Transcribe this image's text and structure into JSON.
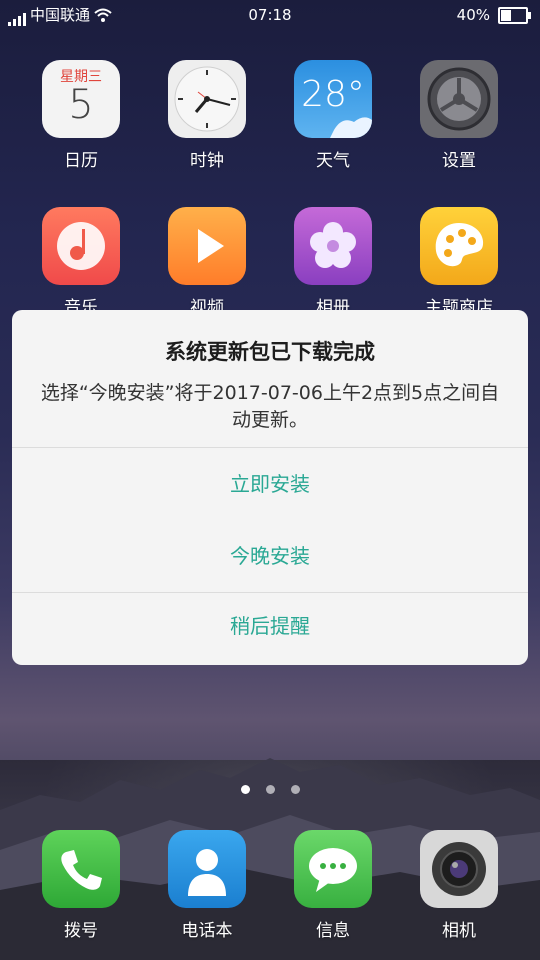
{
  "status_bar": {
    "carrier": "中国联通",
    "time": "07:18",
    "battery_percent": "40%",
    "battery_level": 0.4
  },
  "apps": [
    {
      "name": "calendar",
      "label": "日历",
      "weekday": "星期三",
      "day": "5"
    },
    {
      "name": "clock",
      "label": "时钟"
    },
    {
      "name": "weather",
      "label": "天气",
      "temperature": "28°"
    },
    {
      "name": "settings",
      "label": "设置"
    },
    {
      "name": "music",
      "label": "音乐"
    },
    {
      "name": "video",
      "label": "视频"
    },
    {
      "name": "album",
      "label": "相册"
    },
    {
      "name": "theme-store",
      "label": "主题商店"
    }
  ],
  "dock": [
    {
      "name": "dialer",
      "label": "拨号"
    },
    {
      "name": "contacts",
      "label": "电话本"
    },
    {
      "name": "messages",
      "label": "信息"
    },
    {
      "name": "camera",
      "label": "相机"
    }
  ],
  "page_indicator": {
    "count": 3,
    "active": 0
  },
  "dialog": {
    "title": "系统更新包已下载完成",
    "message": "选择“今晚安装”将于2017-07-06上午2点到5点之间自动更新。",
    "install_now": "立即安装",
    "install_tonight": "今晚安装",
    "remind_later": "稍后提醒",
    "accent_color": "#2aa894"
  }
}
